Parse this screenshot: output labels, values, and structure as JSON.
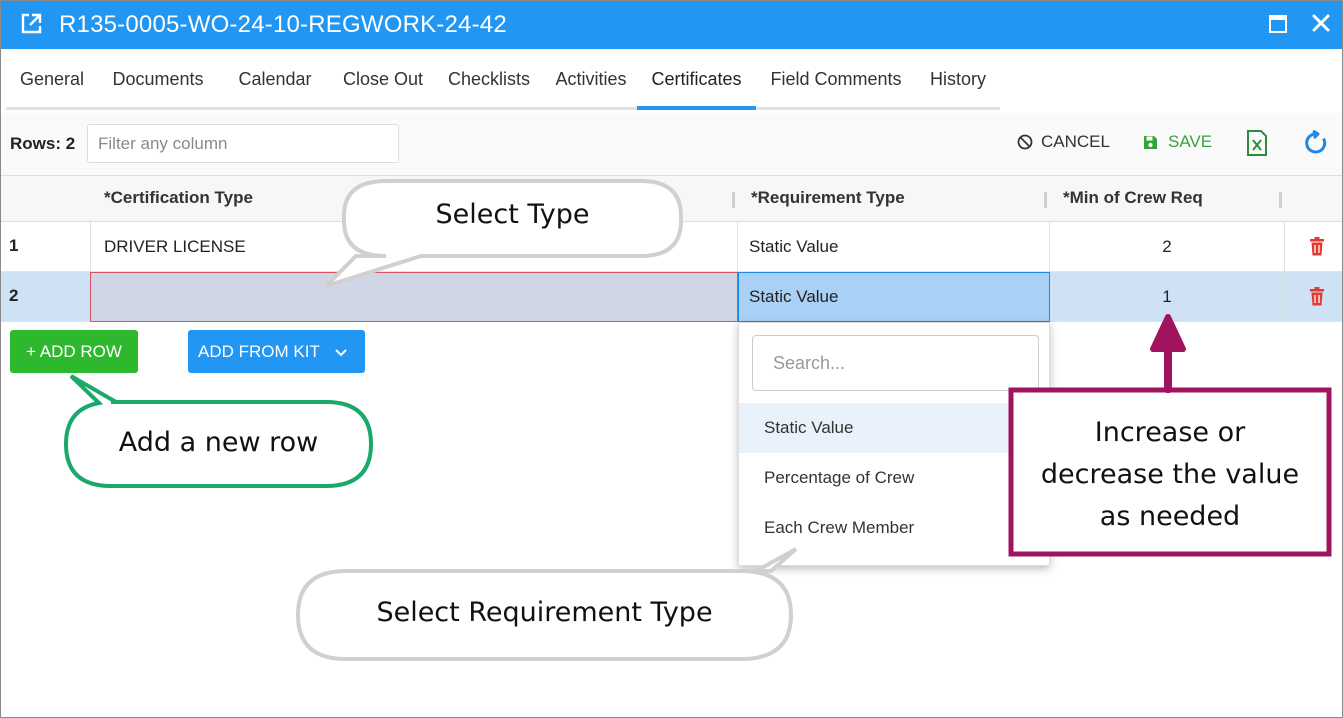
{
  "window": {
    "title": "R135-0005-WO-24-10-REGWORK-24-42"
  },
  "tabs": [
    {
      "label": "General"
    },
    {
      "label": "Documents"
    },
    {
      "label": "Calendar"
    },
    {
      "label": "Close Out"
    },
    {
      "label": "Checklists"
    },
    {
      "label": "Activities"
    },
    {
      "label": "Certificates",
      "active": true
    },
    {
      "label": "Field Comments"
    },
    {
      "label": "History"
    }
  ],
  "toolbar": {
    "rows_label": "Rows:",
    "rows_value": "2",
    "filter_placeholder": "Filter any column",
    "cancel_label": "CANCEL",
    "save_label": "SAVE"
  },
  "grid": {
    "columns": [
      "*Certification Type",
      "*Requirement Type",
      "*Min of Crew Req"
    ],
    "rows": [
      {
        "num": "1",
        "certification_type": "DRIVER LICENSE",
        "requirement_type": "Static Value",
        "min_crew": "2"
      },
      {
        "num": "2",
        "certification_type": "",
        "requirement_type": "Static Value",
        "min_crew": "1"
      }
    ]
  },
  "buttons": {
    "add_row": "+ ADD ROW",
    "add_from_kit": "ADD FROM KIT"
  },
  "dropdown": {
    "search_placeholder": "Search...",
    "options": [
      "Static Value",
      "Percentage of Crew",
      "Each Crew Member"
    ],
    "selected": "Static Value"
  },
  "callouts": {
    "select_type": "Select Type",
    "add_row": "Add a new row",
    "select_requirement": "Select Requirement Type",
    "increase_line1": "Increase or",
    "increase_line2": "decrease the value",
    "increase_line3": "as needed"
  },
  "colors": {
    "title_bar": "#2196f3",
    "add_row_green": "#2eb82e",
    "save_green": "#3aa23a",
    "delete_red": "#e53935",
    "callout_green": "#1aa86b",
    "callout_magenta": "#a0135f",
    "selected_row": "#cfe2f5"
  }
}
